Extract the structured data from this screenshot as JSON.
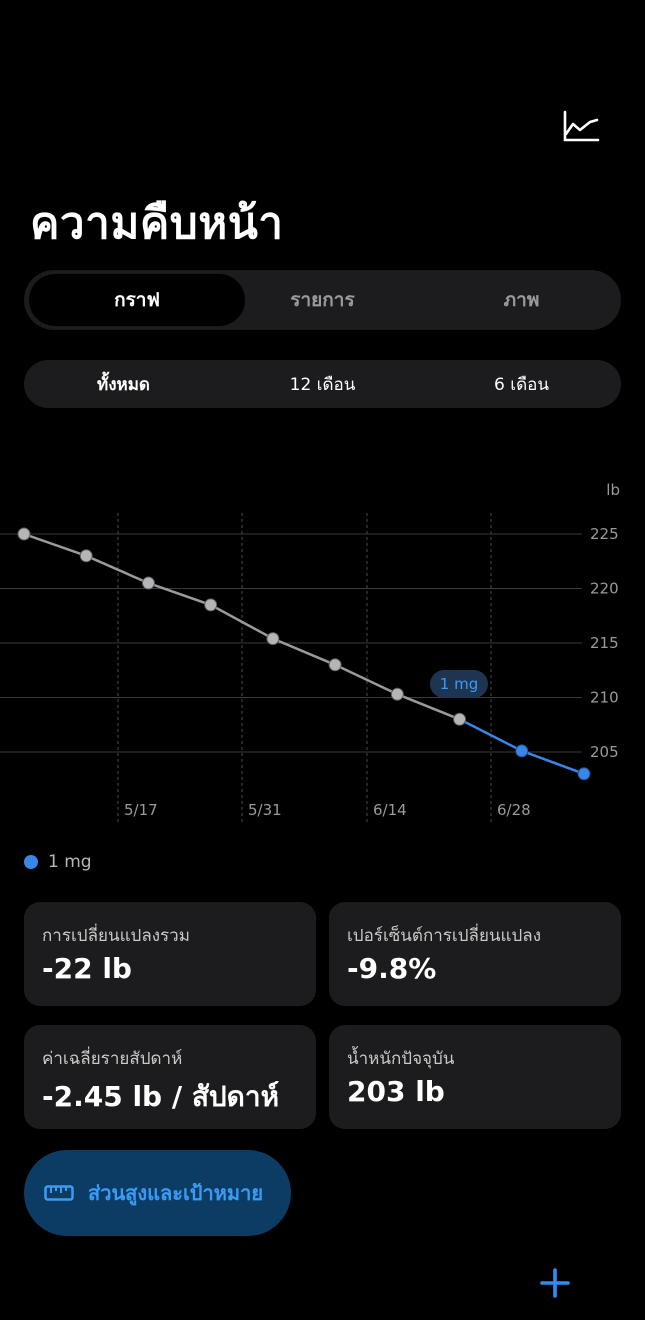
{
  "header": {
    "title": "ความคืบหน้า",
    "trend_icon": "chart-line-icon"
  },
  "view_tabs": [
    {
      "label": "กราฟ",
      "selected": true
    },
    {
      "label": "รายการ",
      "selected": false
    },
    {
      "label": "ภาพ",
      "selected": false
    }
  ],
  "range_tabs": [
    {
      "label": "ทั้งหมด"
    },
    {
      "label": "12 เดือน"
    },
    {
      "label": "6 เดือน"
    }
  ],
  "chart_data": {
    "type": "line",
    "ylabel": "lb",
    "ylim": [
      202,
      226
    ],
    "y_ticks": [
      "225",
      "220",
      "215",
      "210",
      "205"
    ],
    "x_ticks": [
      "5/17",
      "5/31",
      "6/14",
      "6/28"
    ],
    "series": [
      {
        "name": "1 mg",
        "color": "#3a86e8",
        "values": [
          225,
          223,
          220.5,
          218.5,
          215.4,
          213,
          210.3,
          208,
          205.1,
          203
        ]
      }
    ],
    "highlight_start_index": 7,
    "callout": "1 mg",
    "gray_color": "#9a9a9e"
  },
  "legend": {
    "label": "1 mg",
    "color": "#3a86e8"
  },
  "stats": {
    "total_change": {
      "label": "การเปลี่ยนแปลงรวม",
      "value": "-22 lb"
    },
    "percent_change": {
      "label": "เปอร์เซ็นต์การเปลี่ยนแปลง",
      "value": "-9.8%"
    },
    "weekly_avg": {
      "label": "ค่าเฉลี่ยรายสัปดาห์",
      "value": "-2.45 lb / สัปดาห์"
    },
    "current_weight": {
      "label": "น้ำหนักปัจจุบัน",
      "value": "203 lb"
    }
  },
  "goal_button": {
    "label": "ส่วนสูงและเป้าหมาย",
    "icon": "ruler-icon"
  },
  "add_button": {
    "icon": "plus-icon"
  },
  "colors": {
    "accent": "#3a86e8",
    "accent_light": "#3a9bf5"
  }
}
